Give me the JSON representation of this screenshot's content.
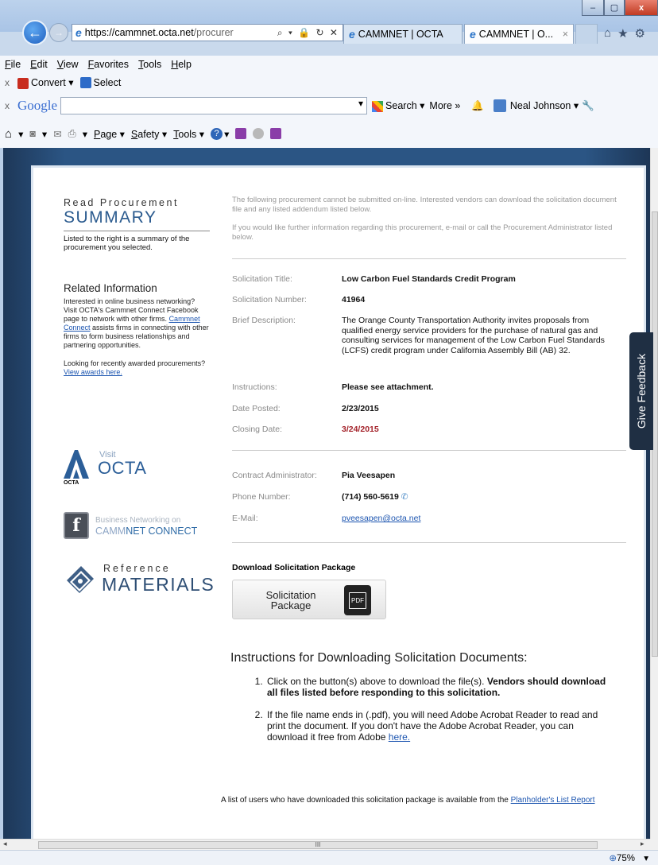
{
  "browser": {
    "url_bold": "https://cammnet.octa.net",
    "url_rest": "/procurer",
    "addr_tools": "⌕ ▾ 🔒 ↻ ✕",
    "tabs": [
      {
        "label": "CAMMNET | OCTA"
      },
      {
        "label": "CAMMNET | O...",
        "close": "×"
      }
    ],
    "window_buttons": {
      "min": "–",
      "max": "▢",
      "close": "x"
    },
    "right_icons": {
      "home": "⌂",
      "star": "★",
      "gear": "⚙"
    },
    "menu": [
      "File",
      "Edit",
      "View",
      "Favorites",
      "Tools",
      "Help"
    ],
    "convertbar": {
      "x": "x",
      "convert": "Convert",
      "convert_arrow": "▾",
      "select": "Select"
    },
    "googlebar": {
      "x": "x",
      "logo": "Google",
      "search": "Search",
      "more": "More »",
      "user": "Neal Johnson",
      "dropdown": "▾",
      "search_arrow": "▾",
      "user_arrow": "▾",
      "wrench": "🔧",
      "bell": "🔔"
    },
    "cmdbar": {
      "home_arrow": "▾",
      "feeds_arrow": "▾",
      "print_arrow": "▾",
      "page": "Page ▾",
      "safety": "Safety ▾",
      "tools": "Tools ▾",
      "help_arrow": "▾",
      "icons": {
        "home": "⌂",
        "feeds": "◙",
        "mail": "✉",
        "print": "⎙",
        "help": "?"
      }
    },
    "zoom": "75%",
    "zoom_icon": "⊕",
    "zoom_arrow": "▾",
    "hscroll_grip": "III",
    "hscroll_left": "◂",
    "hscroll_right": "▸"
  },
  "left": {
    "read": "Read Procurement",
    "summary": "SUMMARY",
    "desc": "Listed to the right is a summary of the procurement you selected.",
    "related_title": "Related Information",
    "related_text_1": "Interested in online business networking? Visit OCTA's Cammnet Connect Facebook page to network with other firms. ",
    "related_link": "Cammnet Connect",
    "related_text_2": " assists firms in connecting with other firms to form business relationships and partnering opportunities.",
    "awarded_text": "Looking for recently awarded procurements?",
    "awarded_link": "View awards here.",
    "octa_visit": "Visit",
    "octa_word": "OCTA",
    "octa_small": "OCTA",
    "cm_line1": "Business Networking on",
    "cm_line2_a": "CAMM",
    "cm_line2_b": "NET CONNECT",
    "fb": "f",
    "ref_l1": "Reference",
    "ref_l2": "MATERIALS"
  },
  "main": {
    "intro_1": "The following procurement cannot be submitted on-line. Interested vendors can download the solicitation document file and any listed addendum listed below.",
    "intro_2": "If you would like further information regarding this procurement, e-mail or call the Procurement Administrator listed below.",
    "fields": {
      "title_lbl": "Solicitation Title:",
      "title_val": "Low Carbon Fuel Standards Credit Program",
      "number_lbl": "Solicitation Number:",
      "number_val": "41964",
      "desc_lbl": "Brief Description:",
      "desc_val": "The Orange County Transportation Authority invites proposals from qualified energy service providers for the purchase of natural gas and consulting services for management of the Low Carbon Fuel Standards (LCFS) credit program under California Assembly Bill (AB) 32.",
      "instr_lbl": "Instructions:",
      "instr_val": "Please see attachment.",
      "posted_lbl": "Date Posted:",
      "posted_val": "2/23/2015",
      "closing_lbl": "Closing Date:",
      "closing_val": "3/24/2015"
    },
    "contact": {
      "admin_lbl": "Contract Administrator:",
      "admin_val": "Pia Veesapen",
      "phone_lbl": "Phone Number:",
      "phone_val": "(714) 560-5619",
      "phone_icon": "✆",
      "email_lbl": "E-Mail:",
      "email_val": "pveesapen@octa.net"
    },
    "download_title": "Download Solicitation Package",
    "download_btn": "Solicitation Package",
    "pdf": "PDF",
    "instructions_title": "Instructions for Downloading Solicitation Documents:",
    "instr1_a": "Click on the button(s) above to download the file(s). ",
    "instr1_b": "Vendors should download all files listed before responding to this solicitation.",
    "instr2_a": "If the file name ends in (.pdf), you will need Adobe Acrobat Reader to read and print the document. If you don't have the Adobe Acrobat Reader, you can download it free from Adobe ",
    "instr2_link": "here.",
    "planholder_text": "A list of users who have downloaded this solicitation package is available from the ",
    "planholder_link": "Planholder's List Report"
  },
  "feedback": "Give Feedback"
}
